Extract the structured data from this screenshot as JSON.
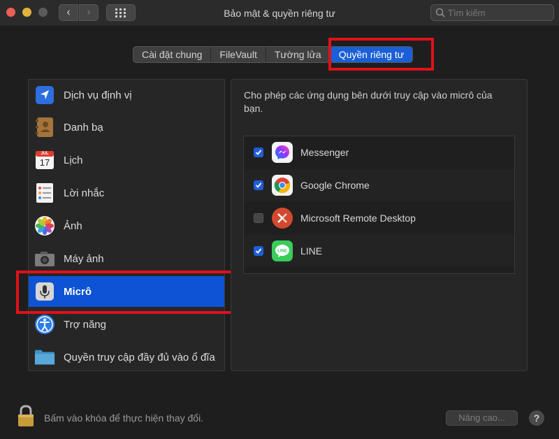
{
  "window": {
    "title": "Bảo mật & quyền riêng tư",
    "search_placeholder": "Tìm kiếm"
  },
  "tabs": [
    {
      "label": "Cài đặt chung"
    },
    {
      "label": "FileVault"
    },
    {
      "label": "Tường lửa"
    },
    {
      "label": "Quyền riêng tư",
      "active": true
    }
  ],
  "sidebar": {
    "items": [
      {
        "label": "Dịch vụ định vị",
        "icon": "location-arrow-icon"
      },
      {
        "label": "Danh bạ",
        "icon": "contacts-book-icon"
      },
      {
        "label": "Lịch",
        "icon": "calendar-icon",
        "calendar_month": "JUL",
        "calendar_day": "17"
      },
      {
        "label": "Lời nhắc",
        "icon": "reminders-icon"
      },
      {
        "label": "Ảnh",
        "icon": "photos-flower-icon"
      },
      {
        "label": "Máy ảnh",
        "icon": "camera-icon"
      },
      {
        "label": "Micrô",
        "icon": "microphone-icon",
        "selected": true
      },
      {
        "label": "Trợ năng",
        "icon": "accessibility-icon"
      },
      {
        "label": "Quyền truy cập đầy đủ vào ổ đĩa",
        "icon": "folder-icon"
      }
    ]
  },
  "main": {
    "description": "Cho phép các ứng dụng bên dưới truy cập vào micrô của bạn.",
    "apps": [
      {
        "label": "Messenger",
        "checked": true,
        "icon": "messenger-icon"
      },
      {
        "label": "Google Chrome",
        "checked": true,
        "icon": "chrome-icon"
      },
      {
        "label": "Microsoft Remote Desktop",
        "checked": false,
        "icon": "remote-desktop-icon"
      },
      {
        "label": "LINE",
        "checked": true,
        "icon": "line-icon"
      }
    ]
  },
  "footer": {
    "lock_text": "Bấm vào khóa để thực hiện thay đổi.",
    "advanced_label": "Nâng cao...",
    "help_label": "?"
  },
  "colors": {
    "accent": "#1b5fd6",
    "highlight_box": "#e0111a",
    "background": "#1e1e1e"
  }
}
